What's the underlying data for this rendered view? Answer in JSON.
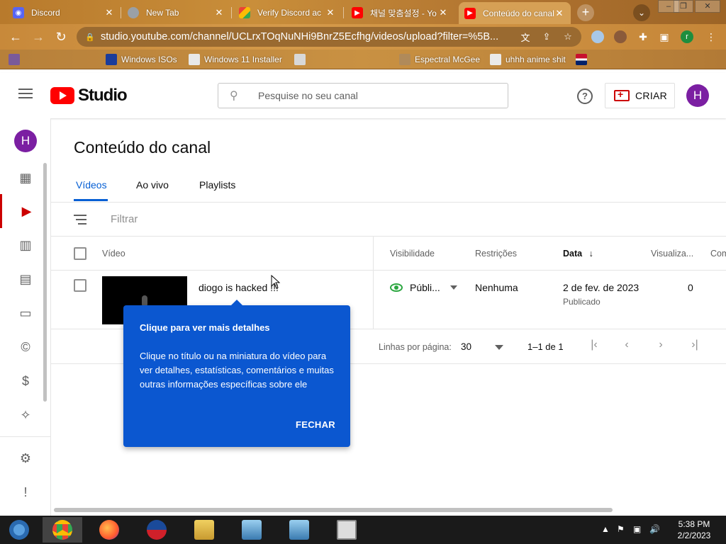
{
  "browser": {
    "tabs": [
      {
        "label": "Discord",
        "color": "#5865f2"
      },
      {
        "label": "New Tab",
        "color": "#9aa0a6"
      },
      {
        "label": "Verify Discord ac",
        "color": "#34a853"
      },
      {
        "label": "채널 맞춤설정 - Yo",
        "color": "#ff0000"
      },
      {
        "label": "Conteúdo do canal",
        "color": "#ff0000"
      }
    ],
    "url": "studio.youtube.com/channel/UCLrxTOqNuNHi9BnrZ5Ecfhg/videos/upload?filter=%5B...",
    "profile_initial": "r",
    "bookmarks": [
      {
        "label": "Windows ISOs"
      },
      {
        "label": "Windows 11 Installer"
      },
      {
        "label": "Espectral McGee"
      },
      {
        "label": "uhhh anime shit"
      }
    ]
  },
  "studio": {
    "logo_text": "Studio",
    "search_placeholder": "Pesquise no seu canal",
    "create_label": "CRIAR",
    "avatar_initial": "H",
    "help_glyph": "?"
  },
  "content": {
    "page_title": "Conteúdo do canal",
    "tabs": [
      {
        "label": "Vídeos",
        "active": true
      },
      {
        "label": "Ao vivo",
        "active": false
      },
      {
        "label": "Playlists",
        "active": false
      }
    ],
    "filter_label": "Filtrar",
    "columns": {
      "video": "Vídeo",
      "visibility": "Visibilidade",
      "restrictions": "Restrições",
      "date": "Data",
      "views": "Visualiza...",
      "comments": "Com"
    },
    "rows": [
      {
        "title": "diogo is hacked !!!",
        "visibility": "Públi...",
        "restrictions": "Nenhuma",
        "date": "2 de fev. de 2023",
        "date_status": "Publicado",
        "views": "0"
      }
    ],
    "pagination": {
      "rows_per_page_label": "Linhas por página:",
      "rows_per_page": "30",
      "range": "1–1 de 1"
    }
  },
  "tooltip": {
    "title": "Clique para ver mais detalhes",
    "body": "Clique no título ou na miniatura do vídeo para ver detalhes, estatísticas, comentários e muitas outras informações específicas sobre ele",
    "close_label": "FECHAR"
  },
  "taskbar": {
    "time": "5:38 PM",
    "date": "2/2/2023"
  },
  "colors": {
    "accent_blue": "#065fd4",
    "tooltip_blue": "#0b57d0",
    "brand_red": "#ff0000",
    "public_green": "#2ba640",
    "avatar_purple": "#7b1fa2"
  }
}
